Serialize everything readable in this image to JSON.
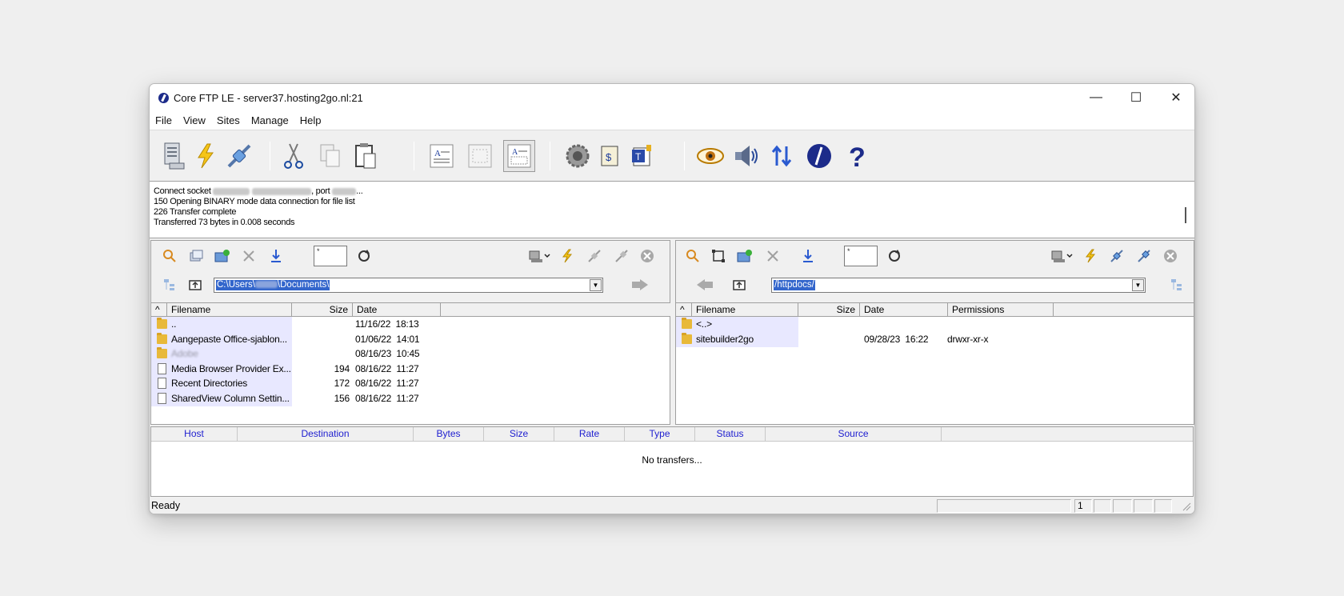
{
  "window": {
    "title": "Core FTP LE - server37.hosting2go.nl:21",
    "minimize": "—",
    "maximize": "☐",
    "close": "✕"
  },
  "menu": [
    "File",
    "View",
    "Sites",
    "Manage",
    "Help"
  ],
  "toolbar_icons": [
    "site-manager-icon",
    "quick-connect-icon",
    "connect-icon",
    "cut-icon",
    "copy-icon",
    "paste-icon",
    "text-view-icon",
    "list-view-icon",
    "detail-view-icon",
    "settings-icon",
    "script-icon",
    "text-editor-icon",
    "view-icon",
    "sound-icon",
    "transfer-icon",
    "about-icon",
    "help-icon"
  ],
  "log": {
    "line1_prefix": "Connect socket",
    "line1_mid": ", port",
    "line1_suffix": "...",
    "line2": "150 Opening BINARY mode data connection for file list",
    "line3": "226 Transfer complete",
    "line4": "Transferred 73 bytes in 0.008 seconds"
  },
  "local": {
    "filter": "*",
    "path": "C:\\Users\\",
    "path_tail": "\\Documents\\",
    "columns": {
      "sort": "^",
      "filename": "Filename",
      "size": "Size",
      "date": "Date"
    },
    "files": [
      {
        "type": "folder",
        "name": "..",
        "size": "",
        "date": "11/16/22  18:13"
      },
      {
        "type": "folder",
        "name": "Aangepaste Office-sjablon...",
        "size": "",
        "date": "01/06/22  14:01"
      },
      {
        "type": "folder",
        "name": "Adobe",
        "size": "",
        "date": "08/16/23  10:45",
        "redacted": true
      },
      {
        "type": "file",
        "name": "Media Browser Provider Ex...",
        "size": "194",
        "date": "08/16/22  11:27"
      },
      {
        "type": "file",
        "name": "Recent Directories",
        "size": "172",
        "date": "08/16/22  11:27"
      },
      {
        "type": "file",
        "name": "SharedView Column Settin...",
        "size": "156",
        "date": "08/16/22  11:27"
      }
    ]
  },
  "remote": {
    "filter": "*",
    "path": "/httpdocs/",
    "columns": {
      "sort": "^",
      "filename": "Filename",
      "size": "Size",
      "date": "Date",
      "permissions": "Permissions"
    },
    "files": [
      {
        "type": "folder",
        "name": "<..>",
        "size": "",
        "date": "",
        "perms": ""
      },
      {
        "type": "folder",
        "name": "sitebuilder2go",
        "size": "",
        "date": "09/28/23  16:22",
        "perms": "drwxr-xr-x"
      }
    ]
  },
  "transfers": {
    "columns": [
      "Host",
      "Destination",
      "Bytes",
      "Size",
      "Rate",
      "Type",
      "Status",
      "Source"
    ],
    "empty": "No transfers..."
  },
  "status": {
    "text": "Ready",
    "count": "1"
  },
  "colors": {
    "accent": "#3366cc",
    "header_text": "#2020d0",
    "folder": "#e8b93a"
  }
}
